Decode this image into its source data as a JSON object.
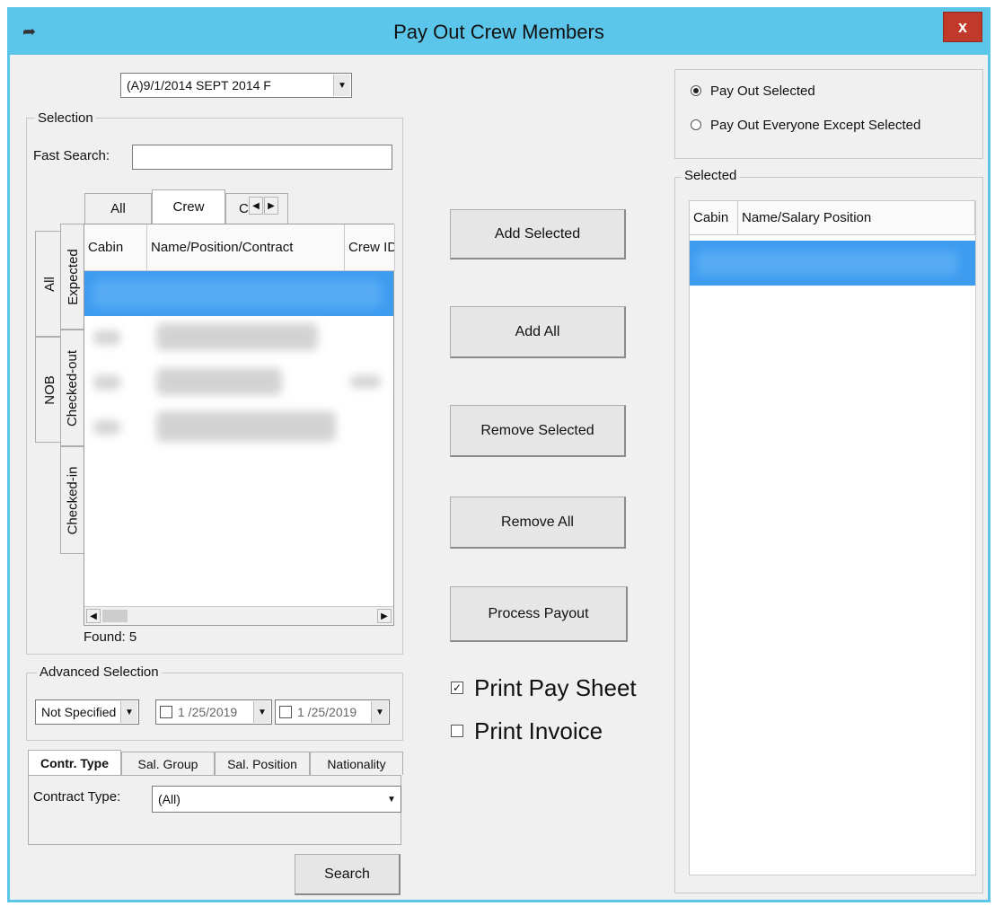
{
  "window": {
    "title": "Pay Out Crew Members",
    "close_label": "x"
  },
  "period_combo": {
    "value": "(A)9/1/2014  SEPT 2014 F"
  },
  "selection": {
    "group_label": "Selection",
    "fast_search_label": "Fast Search:",
    "fast_search_value": "",
    "top_tabs": [
      "All",
      "Crew",
      "C"
    ],
    "side_tabs_outer": [
      "All",
      "NOB"
    ],
    "side_tabs_inner": [
      "Expected",
      "Checked-out",
      "Checked-in"
    ],
    "columns": [
      "Cabin",
      "Name/Position/Contract",
      "Crew ID"
    ],
    "found_label": "Found: 5"
  },
  "advanced": {
    "group_label": "Advanced Selection",
    "status_value": "Not Specified",
    "date_from": "1 /25/2019",
    "date_to": "1 /25/2019",
    "tabs": [
      "Contr. Type",
      "Sal. Group",
      "Sal. Position",
      "Nationality"
    ],
    "contract_type_label": "Contract Type:",
    "contract_type_value": "(All)",
    "search_button": "Search"
  },
  "actions": {
    "add_selected": "Add Selected",
    "add_all": "Add All",
    "remove_selected": "Remove Selected",
    "remove_all": "Remove All",
    "process_payout": "Process Payout"
  },
  "print_options": {
    "print_pay_sheet": {
      "label": "Print Pay Sheet",
      "checked": true
    },
    "print_invoice": {
      "label": "Print Invoice",
      "checked": false
    }
  },
  "payout_mode": {
    "option_selected": "Pay Out Selected",
    "option_except": "Pay Out Everyone Except Selected"
  },
  "selected_panel": {
    "group_label": "Selected",
    "columns": [
      "Cabin",
      "Name/Salary Position"
    ]
  },
  "colors": {
    "title_bar": "#5bc5ea",
    "close": "#c0392b",
    "selection": "#3e9cf0"
  }
}
